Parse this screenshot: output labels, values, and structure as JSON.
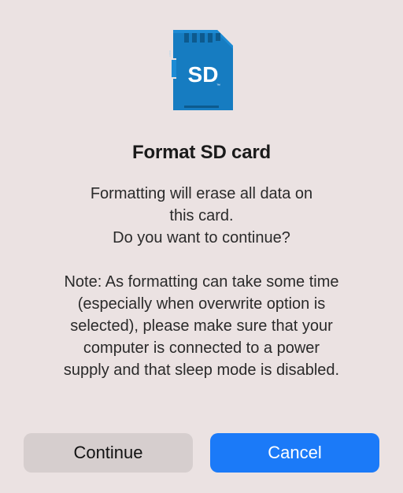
{
  "icon": {
    "name": "sd-card-icon",
    "logo_text": "SD",
    "card_color": "#167cc1",
    "card_color_light": "#1d8bd4"
  },
  "dialog": {
    "title": "Format SD card",
    "body_line1": "Formatting will erase all data on",
    "body_line2": "this card.",
    "body_line3": "Do you want to continue?",
    "note_line1": "Note: As formatting can take some time",
    "note_line2": "(especially when overwrite option is",
    "note_line3": "selected), please make sure that your",
    "note_line4": "computer is connected to a power",
    "note_line5": "supply and that sleep mode is disabled."
  },
  "buttons": {
    "continue_label": "Continue",
    "cancel_label": "Cancel"
  }
}
